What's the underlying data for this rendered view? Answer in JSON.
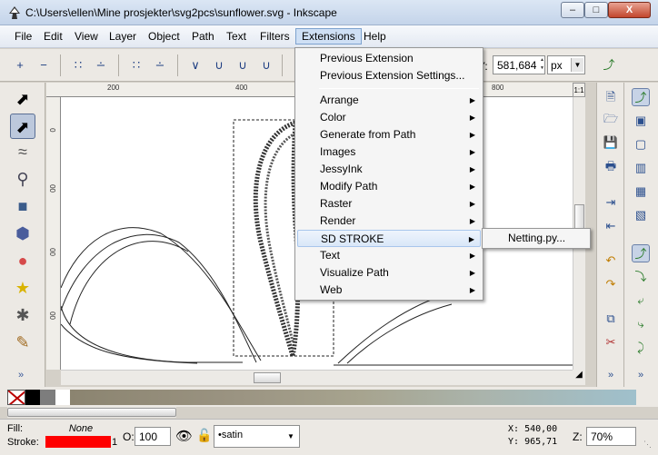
{
  "window": {
    "title": "C:\\Users\\ellen\\Mine prosjekter\\svg2pcs\\sunflower.svg - Inkscape",
    "min_label": "–",
    "max_label": "□",
    "close_label": "X"
  },
  "menubar": [
    "File",
    "Edit",
    "View",
    "Layer",
    "Object",
    "Path",
    "Text",
    "Filters",
    "Extensions",
    "Help"
  ],
  "toolbar": {
    "y_label": "Y:",
    "y_value": "581,684",
    "unit": "px"
  },
  "rulers": {
    "h_ticks": [
      "200",
      "400",
      "600",
      "800"
    ],
    "v_ticks": [
      "0",
      "00",
      "00",
      "00"
    ],
    "corner": "1:1"
  },
  "extensions_menu": {
    "top_items": [
      "Previous Extension",
      "Previous Extension Settings..."
    ],
    "items": [
      "Arrange",
      "Color",
      "Generate from Path",
      "Images",
      "JessyInk",
      "Modify Path",
      "Raster",
      "Render",
      "SD STROKE",
      "Text",
      "Visualize Path",
      "Web"
    ],
    "highlighted": "SD STROKE",
    "submenu": [
      "Netting.py..."
    ]
  },
  "status": {
    "fill_label": "Fill:",
    "fill_value": "None",
    "stroke_label": "Stroke:",
    "stroke_color": "#ff0000",
    "stroke_width": "1",
    "opacity_label": "O:",
    "opacity_value": "100",
    "layer": "•satin",
    "x_label": "X:",
    "x_value": "540,00",
    "y_label": "Y:",
    "y_value": "965,71",
    "zoom_label": "Z:",
    "zoom_value": "70%"
  },
  "more_label": "»"
}
